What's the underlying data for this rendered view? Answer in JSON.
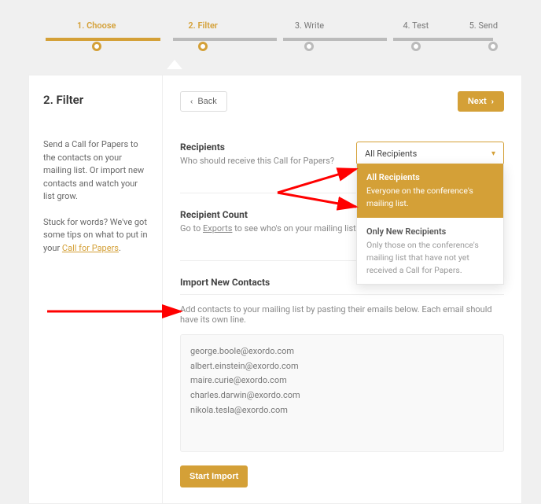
{
  "stepper": {
    "steps": [
      {
        "label": "1. Choose"
      },
      {
        "label": "2. Filter"
      },
      {
        "label": "3. Write"
      },
      {
        "label": "4. Test"
      },
      {
        "label": "5. Send"
      }
    ]
  },
  "left": {
    "title": "2. Filter",
    "para1": "Send a Call for Papers to the contacts on your mailing list. Or import new contacts and watch your list grow.",
    "para2_a": "Stuck for words? We've got some tips on what to put in your ",
    "para2_link": "Call for Papers",
    "para2_b": "."
  },
  "toolbar": {
    "back": "Back",
    "next": "Next"
  },
  "recipients": {
    "heading": "Recipients",
    "sub": "Who should receive this Call for Papers?",
    "selected": "All Recipients"
  },
  "dropdown": {
    "opt1_title": "All Recipients",
    "opt1_desc": "Everyone on the conference's mailing list.",
    "opt2_title": "Only New Recipients",
    "opt2_desc": "Only those on the conference's mailing list that have not yet received a Call for Papers."
  },
  "count": {
    "heading": "Recipient Count",
    "sub_a": "Go to ",
    "sub_link": "Exports",
    "sub_b": " to see who's on your mailing list."
  },
  "import": {
    "heading": "Import New Contacts",
    "sub": "Add contacts to your mailing list by pasting their emails below. Each email should have its own line.",
    "value": "george.boole@exordo.com\nalbert.einstein@exordo.com\nmaire.curie@exordo.com\ncharles.darwin@exordo.com\nnikola.tesla@exordo.com",
    "button": "Start Import"
  }
}
